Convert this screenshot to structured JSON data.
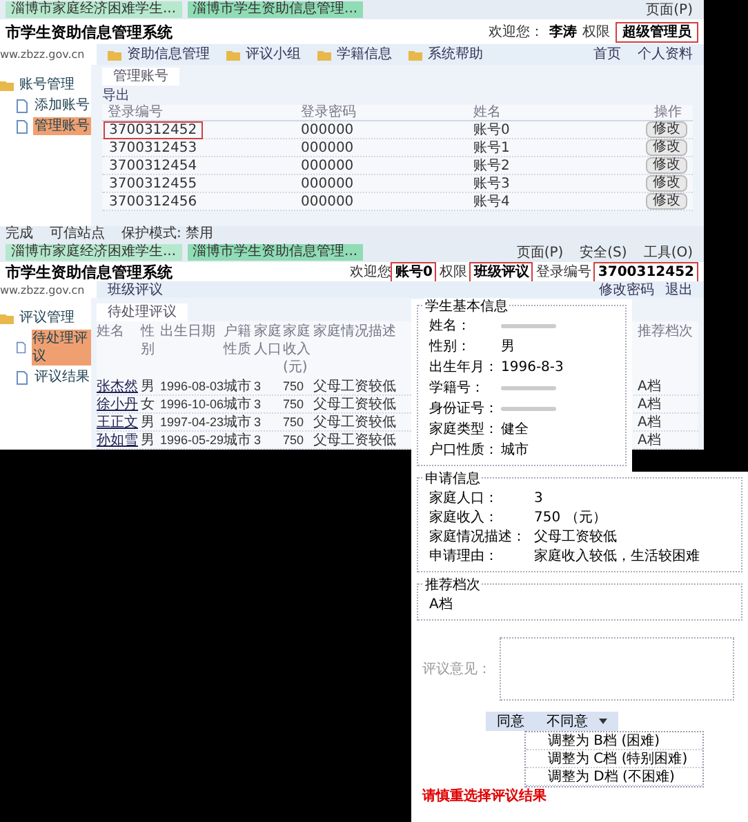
{
  "screenshot_1": {
    "browser_tabs": [
      {
        "title": "淄博市家庭经济困难学生...",
        "selected": false
      },
      {
        "title": "淄博市学生资助信息管理...",
        "selected": true
      }
    ],
    "toolbar": [
      "页面(P)"
    ],
    "site_title": "市学生资助信息管理系统",
    "site_url": "ww.zbzz.gov.cn",
    "welcome": "欢迎您：",
    "user": "李涛",
    "role_label": "权限",
    "role": "超级管理员",
    "nav": [
      "资助信息管理",
      "评议小组",
      "学籍信息",
      "系统帮助"
    ],
    "nav_right": [
      "首页",
      "个人资料"
    ],
    "sidebar": {
      "group": "账号管理",
      "items": [
        {
          "label": "添加账号",
          "selected": false
        },
        {
          "label": "管理账号",
          "selected": true
        }
      ]
    },
    "tab": "管理账号",
    "export": "导出",
    "columns": [
      "登录编号",
      "登录密码",
      "姓名",
      "操作"
    ],
    "rows": [
      {
        "id": "3700312452",
        "password": "000000",
        "name": "账号0",
        "action": "修改",
        "highlighted": true
      },
      {
        "id": "3700312453",
        "password": "000000",
        "name": "账号1",
        "action": "修改",
        "highlighted": false
      },
      {
        "id": "3700312454",
        "password": "000000",
        "name": "账号2",
        "action": "修改",
        "highlighted": false
      },
      {
        "id": "3700312455",
        "password": "000000",
        "name": "账号3",
        "action": "修改",
        "highlighted": false
      },
      {
        "id": "3700312456",
        "password": "000000",
        "name": "账号4",
        "action": "修改",
        "highlighted": false
      }
    ],
    "status_bar": [
      "完成",
      "可信站点",
      "保护模式: 禁用"
    ]
  },
  "screenshot_2": {
    "browser_tabs": [
      {
        "title": "淄博市家庭经济困难学生...",
        "selected": false
      },
      {
        "title": "淄博市学生资助信息管理...",
        "selected": true
      }
    ],
    "toolbar": [
      "页面(P)",
      "安全(S)",
      "工具(O)"
    ],
    "site_title": "市学生资助信息管理系统",
    "site_url": "ww.zbzz.gov.cn",
    "welcome": "欢迎您",
    "user": "账号0",
    "role_label": "权限",
    "role": "班级评议",
    "login_label": "登录编号",
    "login_id": "3700312452",
    "links": [
      "修改密码",
      "退出"
    ],
    "nav": "班级评议",
    "sidebar": {
      "group": "评议管理",
      "items": [
        {
          "label": "待处理评议",
          "selected": true
        },
        {
          "label": "评议结果",
          "selected": false
        }
      ]
    },
    "tab": "待处理评议",
    "columns": [
      "姓名",
      "性别",
      "出生日期",
      "户籍性质",
      "家庭人口",
      "家庭收入(元)",
      "家庭情况描述"
    ],
    "last_column": "推荐档次",
    "rows": [
      {
        "cells": [
          "张杰然",
          "男",
          "1996-08-03",
          "城市",
          "3",
          "750",
          "父母工资较低"
        ],
        "grade": "A档"
      },
      {
        "cells": [
          "徐小丹",
          "女",
          "1996-10-06",
          "城市",
          "3",
          "750",
          "父母工资较低"
        ],
        "grade": "A档"
      },
      {
        "cells": [
          "王正文",
          "男",
          "1997-04-23",
          "城市",
          "3",
          "750",
          "父母工资较低"
        ],
        "grade": "A档"
      },
      {
        "cells": [
          "孙如雪",
          "男",
          "1996-05-29",
          "城市",
          "3",
          "750",
          "父母工资较低"
        ],
        "grade": "A档"
      }
    ]
  },
  "dialog": {
    "basic": {
      "title": "学生基本信息",
      "fields": [
        {
          "label": "姓名：",
          "kind": "redacted"
        },
        {
          "label": "性别：",
          "kind": "text",
          "value": "男"
        },
        {
          "label": "出生年月：",
          "kind": "text",
          "value": "1996-8-3"
        },
        {
          "label": "学籍号：",
          "kind": "redacted"
        },
        {
          "label": "身份证号：",
          "kind": "redacted"
        },
        {
          "label": "家庭类型：",
          "kind": "text",
          "value": "健全"
        },
        {
          "label": "户口性质：",
          "kind": "text",
          "value": "城市"
        }
      ]
    },
    "application": {
      "title": "申请信息",
      "fields": [
        {
          "label": "家庭人口：",
          "value": "3"
        },
        {
          "label": "家庭收入：",
          "value": "750 （元）"
        },
        {
          "label": "家庭情况描述：",
          "value": "父母工资较低"
        },
        {
          "label": "申请理由：",
          "value": "家庭收入较低，生活较困难"
        }
      ]
    },
    "recommend": {
      "title": "推荐档次",
      "value": "A档"
    },
    "comment_label": "评议意见：",
    "buttons": [
      {
        "label": "同意",
        "kind": "plain"
      },
      {
        "label": "不同意",
        "kind": "menu"
      }
    ],
    "menu": [
      "调整为 B档 (困难)",
      "调整为 C档 (特别困难)",
      "调整为 D档 (不困难)"
    ],
    "warning": "请慎重选择评议结果"
  }
}
